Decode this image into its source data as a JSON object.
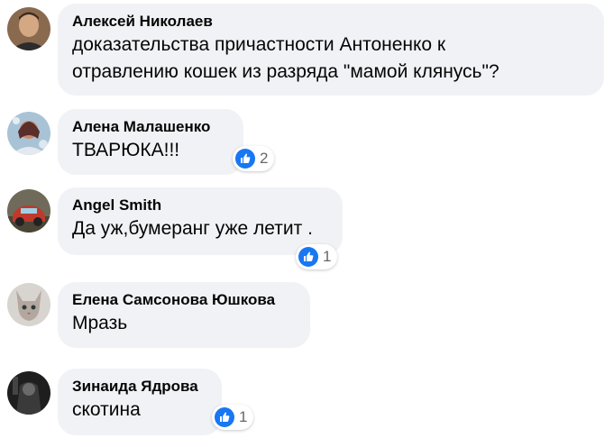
{
  "comments": [
    {
      "author": "Алексей Николаев",
      "lines": [
        "доказательства причастности Антоненко к",
        "отравлению кошек из разряда \"мамой клянусь\"?"
      ],
      "reactions": ""
    },
    {
      "author": "Алена Малашенко",
      "lines": [
        "ТВАРЮКА!!!"
      ],
      "reactions": "2"
    },
    {
      "author": "Angel Smith",
      "lines": [
        "Да уж,бумеранг уже летит ."
      ],
      "reactions": "1"
    },
    {
      "author": "Елена Самсонова Юшкова",
      "lines": [
        "Мразь"
      ],
      "reactions": ""
    },
    {
      "author": "Зинаида Ядрова",
      "lines": [
        "скотина"
      ],
      "reactions": "1"
    }
  ],
  "colors": {
    "bubble": "#f0f2f5",
    "like_blue": "#1877f2",
    "author_text": "#050505",
    "count_text": "#65676b"
  },
  "icons": [
    "like-thumbs-up-icon"
  ]
}
